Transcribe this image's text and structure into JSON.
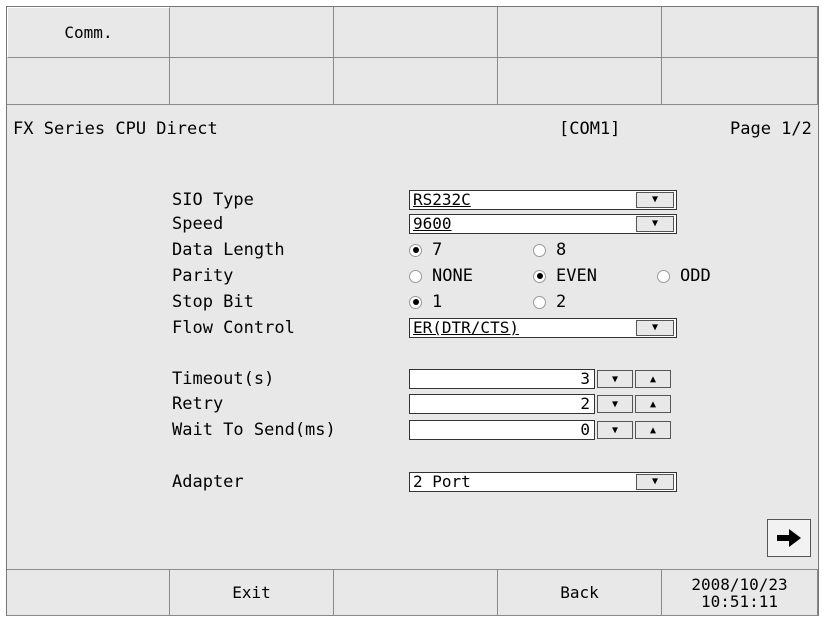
{
  "top_tabs_row1": [
    "Comm.",
    "",
    "",
    "",
    ""
  ],
  "top_tabs_row2": [
    "",
    "",
    "",
    "",
    ""
  ],
  "header": {
    "title": "FX Series CPU Direct",
    "port": "[COM1]",
    "page": "Page 1/2"
  },
  "fields": {
    "sio_type": {
      "label": "SIO Type",
      "value": "RS232C"
    },
    "speed": {
      "label": "Speed",
      "value": "9600"
    },
    "data_length": {
      "label": "Data Length",
      "options": [
        "7",
        "8"
      ],
      "selected": "7"
    },
    "parity": {
      "label": "Parity",
      "options": [
        "NONE",
        "EVEN",
        "ODD"
      ],
      "selected": "EVEN"
    },
    "stop_bit": {
      "label": "Stop Bit",
      "options": [
        "1",
        "2"
      ],
      "selected": "1"
    },
    "flow_control": {
      "label": "Flow Control",
      "value": "ER(DTR/CTS)"
    },
    "timeout": {
      "label": "Timeout(s)",
      "value": "3"
    },
    "retry": {
      "label": "Retry",
      "value": "2"
    },
    "wait_to_send": {
      "label": "Wait To Send(ms)",
      "value": "0"
    },
    "adapter": {
      "label": "Adapter",
      "value": "2 Port"
    }
  },
  "footer": {
    "exit": "Exit",
    "back": "Back",
    "date": "2008/10/23",
    "time": "10:51:11"
  },
  "icons": {
    "dropdown": "triangle-down-icon",
    "spin_down": "triangle-down-icon",
    "spin_up": "triangle-up-icon",
    "next": "arrow-right-icon"
  }
}
